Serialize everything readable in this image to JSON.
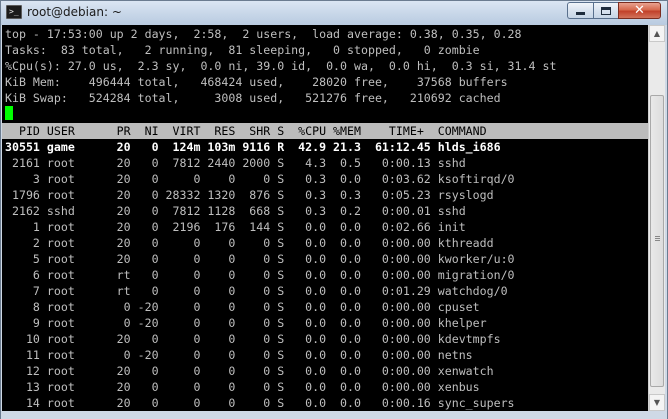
{
  "window": {
    "title": "root@debian: ~",
    "icon": "terminal-icon",
    "icon_glyph": ">_",
    "minimize_icon": "minimize-icon",
    "maximize_icon": "maximize-icon",
    "close_icon": "close-icon",
    "close_glyph": "✕"
  },
  "summary": {
    "uptime_line": "top - 17:53:00 up 2 days,  2:58,  2 users,  load average: 0.38, 0.35, 0.28",
    "tasks_line": "Tasks:  83 total,   2 running,  81 sleeping,   0 stopped,   0 zombie",
    "cpu_line": "%Cpu(s): 27.0 us,  2.3 sy,  0.0 ni, 39.0 id,  0.0 wa,  0.0 hi,  0.3 si, 31.4 st",
    "mem_line": "KiB Mem:    496444 total,   468424 used,    28020 free,    37568 buffers",
    "swap_line": "KiB Swap:   524284 total,     3008 used,   521276 free,   210692 cached"
  },
  "process_table": {
    "header_line": "  PID USER      PR  NI  VIRT  RES  SHR S  %CPU %MEM    TIME+  COMMAND",
    "columns": [
      "PID",
      "USER",
      "PR",
      "NI",
      "VIRT",
      "RES",
      "SHR",
      "S",
      "%CPU",
      "%MEM",
      "TIME+",
      "COMMAND"
    ],
    "rows": [
      {
        "pid": "30551",
        "user": "game",
        "pr": "20",
        "ni": "0",
        "virt": "124m",
        "res": "103m",
        "shr": "9116",
        "s": "R",
        "cpu": "42.9",
        "mem": "21.3",
        "time": "61:12.45",
        "command": "hlds_i686",
        "line": "30551 game      20   0  124m 103m 9116 R  42.9 21.3  61:12.45 hlds_i686"
      },
      {
        "pid": "2161",
        "user": "root",
        "pr": "20",
        "ni": "0",
        "virt": "7812",
        "res": "2440",
        "shr": "2000",
        "s": "S",
        "cpu": "4.3",
        "mem": "0.5",
        "time": "0:00.13",
        "command": "sshd",
        "line": " 2161 root      20   0  7812 2440 2000 S   4.3  0.5   0:00.13 sshd"
      },
      {
        "pid": "3",
        "user": "root",
        "pr": "20",
        "ni": "0",
        "virt": "0",
        "res": "0",
        "shr": "0",
        "s": "S",
        "cpu": "0.3",
        "mem": "0.0",
        "time": "0:03.62",
        "command": "ksoftirqd/0",
        "line": "    3 root      20   0     0    0    0 S   0.3  0.0   0:03.62 ksoftirqd/0"
      },
      {
        "pid": "1796",
        "user": "root",
        "pr": "20",
        "ni": "0",
        "virt": "28332",
        "res": "1320",
        "shr": "876",
        "s": "S",
        "cpu": "0.3",
        "mem": "0.3",
        "time": "0:05.23",
        "command": "rsyslogd",
        "line": " 1796 root      20   0 28332 1320  876 S   0.3  0.3   0:05.23 rsyslogd"
      },
      {
        "pid": "2162",
        "user": "sshd",
        "pr": "20",
        "ni": "0",
        "virt": "7812",
        "res": "1128",
        "shr": "668",
        "s": "S",
        "cpu": "0.3",
        "mem": "0.2",
        "time": "0:00.01",
        "command": "sshd",
        "line": " 2162 sshd      20   0  7812 1128  668 S   0.3  0.2   0:00.01 sshd"
      },
      {
        "pid": "1",
        "user": "root",
        "pr": "20",
        "ni": "0",
        "virt": "2196",
        "res": "176",
        "shr": "144",
        "s": "S",
        "cpu": "0.0",
        "mem": "0.0",
        "time": "0:02.66",
        "command": "init",
        "line": "    1 root      20   0  2196  176  144 S   0.0  0.0   0:02.66 init"
      },
      {
        "pid": "2",
        "user": "root",
        "pr": "20",
        "ni": "0",
        "virt": "0",
        "res": "0",
        "shr": "0",
        "s": "S",
        "cpu": "0.0",
        "mem": "0.0",
        "time": "0:00.00",
        "command": "kthreadd",
        "line": "    2 root      20   0     0    0    0 S   0.0  0.0   0:00.00 kthreadd"
      },
      {
        "pid": "5",
        "user": "root",
        "pr": "20",
        "ni": "0",
        "virt": "0",
        "res": "0",
        "shr": "0",
        "s": "S",
        "cpu": "0.0",
        "mem": "0.0",
        "time": "0:00.00",
        "command": "kworker/u:0",
        "line": "    5 root      20   0     0    0    0 S   0.0  0.0   0:00.00 kworker/u:0"
      },
      {
        "pid": "6",
        "user": "root",
        "pr": "rt",
        "ni": "0",
        "virt": "0",
        "res": "0",
        "shr": "0",
        "s": "S",
        "cpu": "0.0",
        "mem": "0.0",
        "time": "0:00.00",
        "command": "migration/0",
        "line": "    6 root      rt   0     0    0    0 S   0.0  0.0   0:00.00 migration/0"
      },
      {
        "pid": "7",
        "user": "root",
        "pr": "rt",
        "ni": "0",
        "virt": "0",
        "res": "0",
        "shr": "0",
        "s": "S",
        "cpu": "0.0",
        "mem": "0.0",
        "time": "0:01.29",
        "command": "watchdog/0",
        "line": "    7 root      rt   0     0    0    0 S   0.0  0.0   0:01.29 watchdog/0"
      },
      {
        "pid": "8",
        "user": "root",
        "pr": "0",
        "ni": "-20",
        "virt": "0",
        "res": "0",
        "shr": "0",
        "s": "S",
        "cpu": "0.0",
        "mem": "0.0",
        "time": "0:00.00",
        "command": "cpuset",
        "line": "    8 root       0 -20     0    0    0 S   0.0  0.0   0:00.00 cpuset"
      },
      {
        "pid": "9",
        "user": "root",
        "pr": "0",
        "ni": "-20",
        "virt": "0",
        "res": "0",
        "shr": "0",
        "s": "S",
        "cpu": "0.0",
        "mem": "0.0",
        "time": "0:00.00",
        "command": "khelper",
        "line": "    9 root       0 -20     0    0    0 S   0.0  0.0   0:00.00 khelper"
      },
      {
        "pid": "10",
        "user": "root",
        "pr": "20",
        "ni": "0",
        "virt": "0",
        "res": "0",
        "shr": "0",
        "s": "S",
        "cpu": "0.0",
        "mem": "0.0",
        "time": "0:00.00",
        "command": "kdevtmpfs",
        "line": "   10 root      20   0     0    0    0 S   0.0  0.0   0:00.00 kdevtmpfs"
      },
      {
        "pid": "11",
        "user": "root",
        "pr": "0",
        "ni": "-20",
        "virt": "0",
        "res": "0",
        "shr": "0",
        "s": "S",
        "cpu": "0.0",
        "mem": "0.0",
        "time": "0:00.00",
        "command": "netns",
        "line": "   11 root       0 -20     0    0    0 S   0.0  0.0   0:00.00 netns"
      },
      {
        "pid": "12",
        "user": "root",
        "pr": "20",
        "ni": "0",
        "virt": "0",
        "res": "0",
        "shr": "0",
        "s": "S",
        "cpu": "0.0",
        "mem": "0.0",
        "time": "0:00.00",
        "command": "xenwatch",
        "line": "   12 root      20   0     0    0    0 S   0.0  0.0   0:00.00 xenwatch"
      },
      {
        "pid": "13",
        "user": "root",
        "pr": "20",
        "ni": "0",
        "virt": "0",
        "res": "0",
        "shr": "0",
        "s": "S",
        "cpu": "0.0",
        "mem": "0.0",
        "time": "0:00.00",
        "command": "xenbus",
        "line": "   13 root      20   0     0    0    0 S   0.0  0.0   0:00.00 xenbus"
      },
      {
        "pid": "14",
        "user": "root",
        "pr": "20",
        "ni": "0",
        "virt": "0",
        "res": "0",
        "shr": "0",
        "s": "S",
        "cpu": "0.0",
        "mem": "0.0",
        "time": "0:00.16",
        "command": "sync_supers",
        "line": "   14 root      20   0     0    0    0 S   0.0  0.0   0:00.16 sync_supers"
      }
    ]
  },
  "scrollbar": {
    "up_icon": "scroll-up-arrow-icon",
    "down_icon": "scroll-down-arrow-icon",
    "up_glyph": "▲",
    "down_glyph": "▼"
  },
  "colors": {
    "terminal_bg": "#000000",
    "terminal_fg": "#bfbfbf",
    "header_bar_bg": "#bcbcbc",
    "cursor": "#00ff00",
    "titlebar": "#c7d6e8",
    "close_button": "#c2412a"
  }
}
